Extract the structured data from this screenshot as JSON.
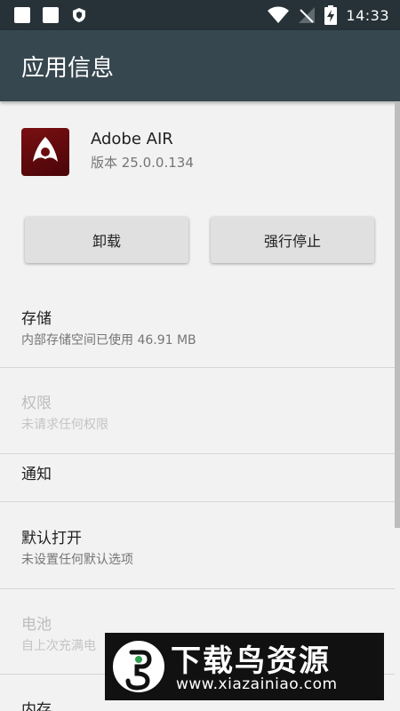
{
  "status_bar": {
    "time": "14:33",
    "icons": [
      "notification-square-icon",
      "notification-square-icon",
      "shield-icon",
      "wifi-icon",
      "no-signal-icon",
      "battery-charging-icon"
    ]
  },
  "toolbar": {
    "title": "应用信息"
  },
  "app": {
    "name": "Adobe AIR",
    "version": "版本 25.0.0.134",
    "icon": "adobe-air-icon"
  },
  "buttons": {
    "uninstall": "卸载",
    "force_stop": "强行停止"
  },
  "items": [
    {
      "title": "存储",
      "subtitle": "内部存储空间已使用 46.91 MB",
      "enabled": true
    },
    {
      "title": "权限",
      "subtitle": "未请求任何权限",
      "enabled": false
    },
    {
      "title": "通知",
      "subtitle": "",
      "enabled": true
    },
    {
      "title": "默认打开",
      "subtitle": "未设置任何默认选项",
      "enabled": true
    },
    {
      "title": "电池",
      "subtitle": "自上次充满电",
      "enabled": false
    },
    {
      "title": "内存",
      "subtitle": "",
      "enabled": true
    }
  ],
  "watermark": {
    "title": "下载鸟资源",
    "url": "www.xiazainiao.com"
  },
  "colors": {
    "status_bar": "#263238",
    "toolbar": "#37474f",
    "background": "#f2f2f2",
    "button": "#e0e0e0",
    "app_icon": "#6b0d10"
  }
}
